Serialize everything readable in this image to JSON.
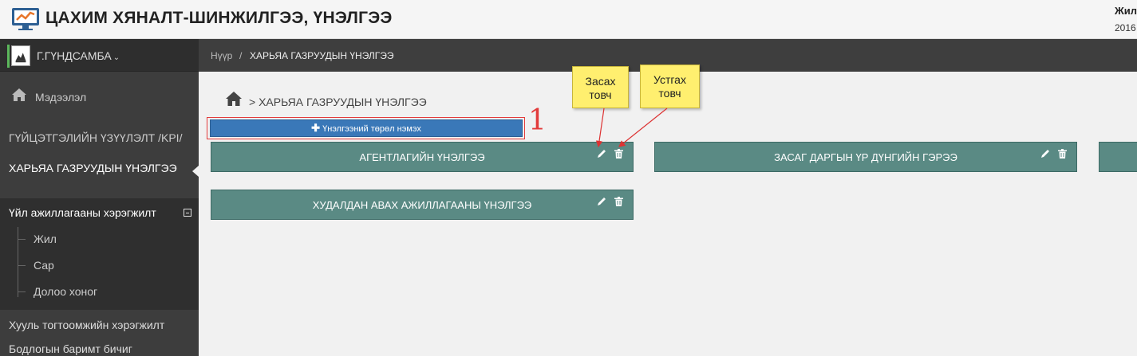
{
  "header": {
    "app_title": "ЦАХИМ ХЯНАЛТ-ШИНЖИЛГЭЭ, ҮНЭЛГЭЭ",
    "right_label": "Жил",
    "right_value": "2016",
    "logo_icon": "monitor-chart-icon"
  },
  "sidebar": {
    "user_name": "Г.ГҮНДСАМБА",
    "chevron": "⌄",
    "info_label": "Мэдээлэл",
    "kpi_label": "ГҮЙЦЭТГЭЛИЙН ҮЗҮҮЛЭЛТ /KPI/",
    "active_label": "ХАРЬЯА ГАЗРУУДЫН ҮНЭЛГЭЭ",
    "group_label": "Үйл ажиллагааны хэрэгжилт",
    "group_items": [
      "Жил",
      "Сар",
      "Долоо хоног"
    ],
    "law_label": "Хууль тогтоомжийн хэрэгжилт",
    "doc_label": "Бодлогын баримт бичиг"
  },
  "breadcrumb": {
    "home": "Нүүр",
    "separator": "/",
    "current": "ХАРЬЯА ГАЗРУУДЫН ҮНЭЛГЭЭ"
  },
  "page": {
    "title": "> ХАРЬЯА ГАЗРУУДЫН ҮНЭЛГЭЭ",
    "add_button_label": "Үнэлгээний төрөл нэмэх",
    "annotation_number": "1",
    "cards": [
      {
        "title": "АГЕНТЛАГИЙН ҮНЭЛГЭЭ"
      },
      {
        "title": "ЗАСАГ ДАРГЫН ҮР ДҮНГИЙН ГЭРЭЭ"
      },
      {
        "title": ""
      },
      {
        "title": "ХУДАЛДАН АВАХ АЖИЛЛАГААНЫ ҮНЭЛГЭЭ"
      }
    ]
  },
  "callouts": {
    "edit_line1": "Засах",
    "edit_line2": "товч",
    "delete_line1": "Устгах",
    "delete_line2": "товч"
  },
  "colors": {
    "card": "#5a8a84",
    "add_button": "#3a78b8",
    "annotation": "#e23b3b",
    "callout": "#ffef6f",
    "sidebar": "#3d3d3d"
  }
}
